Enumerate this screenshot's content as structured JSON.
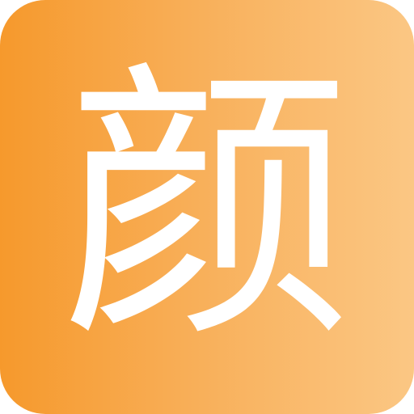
{
  "app_icon": {
    "glyph": "颜",
    "background_colors": [
      "#F6992C",
      "#F8AE57",
      "#FBC784"
    ],
    "glyph_color": "#FFFFFF"
  }
}
